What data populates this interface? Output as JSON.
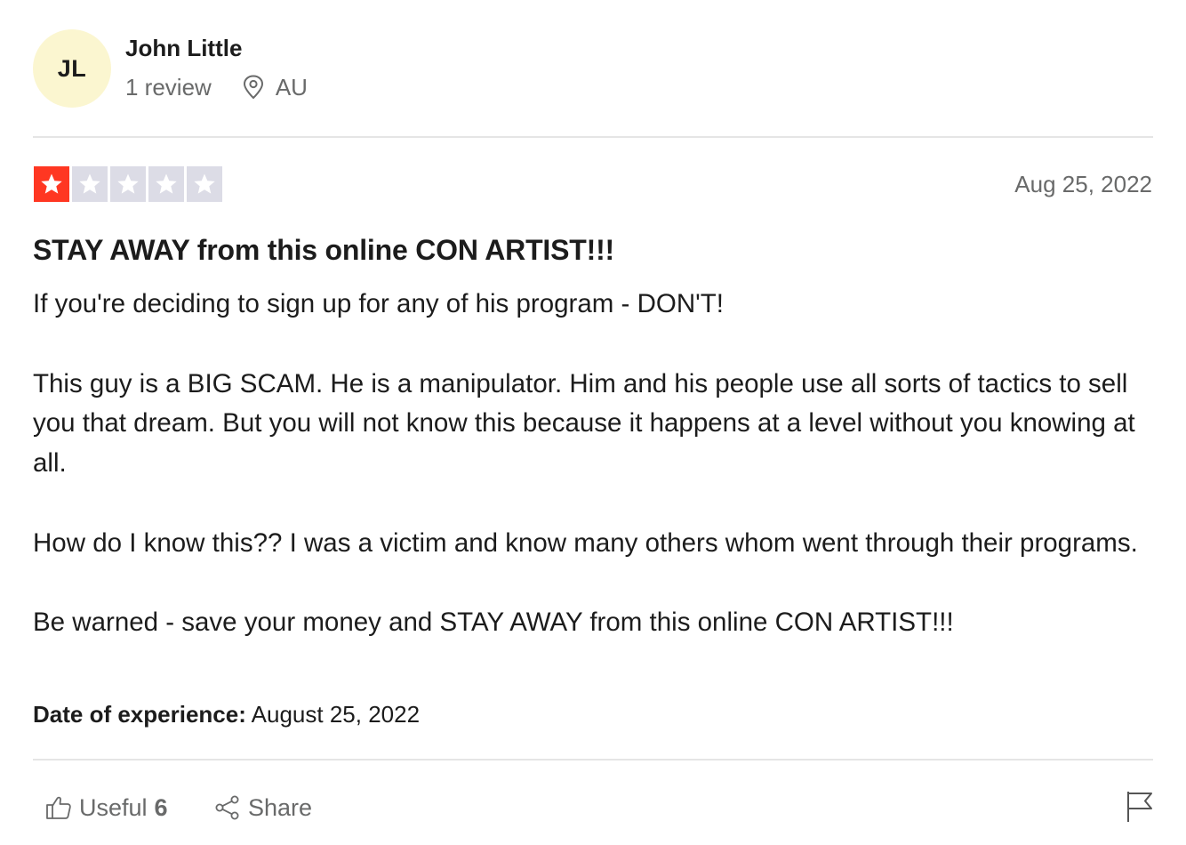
{
  "reviewer": {
    "initials": "JL",
    "name": "John Little",
    "review_count": "1 review",
    "country": "AU"
  },
  "rating": {
    "stars": 1,
    "max_stars": 5,
    "filled_color": "#ff3722",
    "empty_color": "#dcdce6"
  },
  "review": {
    "date": "Aug 25, 2022",
    "title": "STAY AWAY from this online CON ARTIST!!!",
    "paragraphs": [
      "If you're deciding to sign up for any of his program - DON'T!",
      "This guy is a BIG SCAM. He is a manipulator. Him and his people use all sorts of tactics to sell you that dream. But you will not know this because it happens at a level without you knowing at all.",
      "How do I know this?? I was a victim and know many others whom went through their programs.",
      "Be warned - save your money and STAY AWAY from this online CON ARTIST!!!"
    ],
    "experience_label": "Date of experience:",
    "experience_date": "August 25, 2022"
  },
  "actions": {
    "useful_label": "Useful",
    "useful_count": "6",
    "share_label": "Share",
    "icons": [
      "thumbs-up-icon",
      "share-icon",
      "flag-icon",
      "location-pin-icon",
      "star-icon"
    ]
  }
}
